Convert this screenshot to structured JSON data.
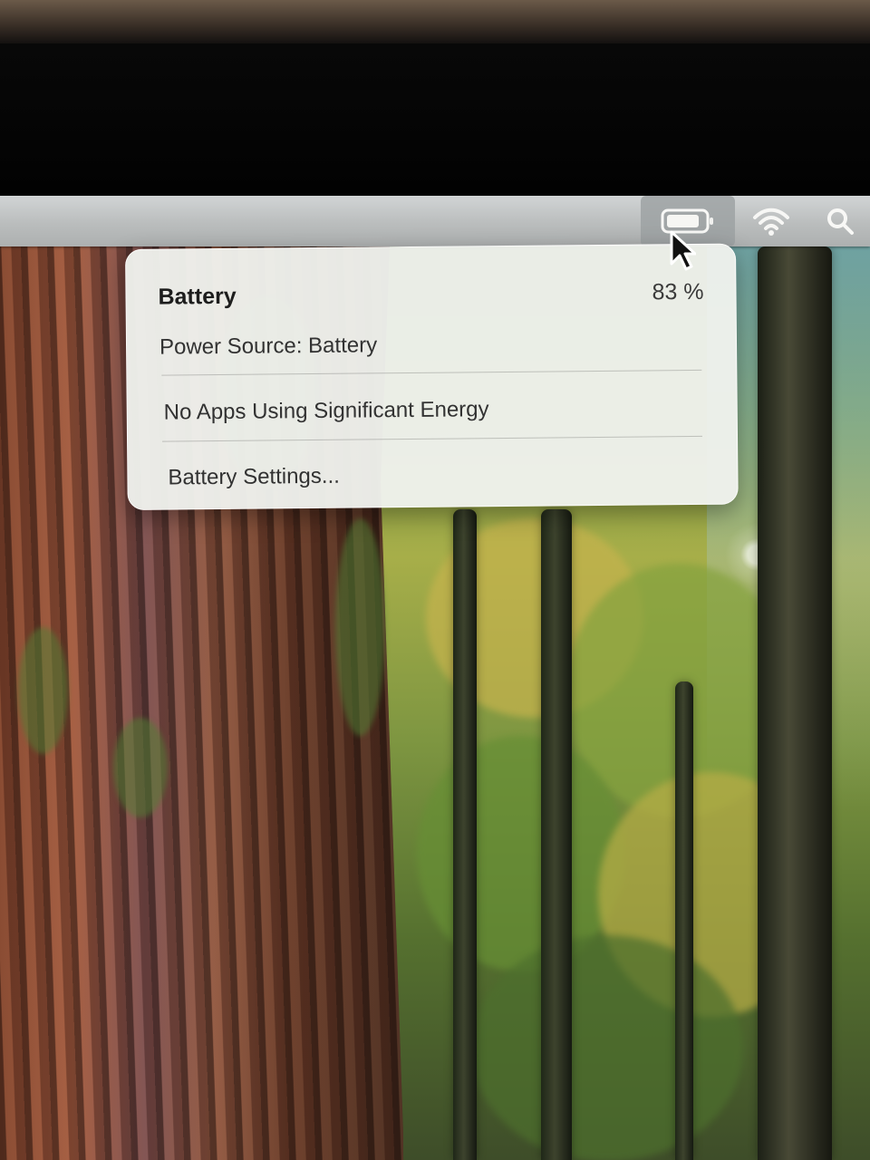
{
  "menu_bar": {
    "status_items": [
      {
        "name": "battery",
        "icon": "battery-icon",
        "selected": true
      },
      {
        "name": "wifi",
        "icon": "wifi-icon"
      },
      {
        "name": "spotlight",
        "icon": "search-icon"
      }
    ]
  },
  "battery_menu": {
    "title": "Battery",
    "percentage": "83 %",
    "power_source": "Power Source: Battery",
    "energy_status": "No Apps Using Significant Energy",
    "settings_label": "Battery Settings..."
  },
  "colors": {
    "menu_bar": "#c3c6c7",
    "popover": "#eff1ed",
    "text": "#2a2a2a"
  }
}
